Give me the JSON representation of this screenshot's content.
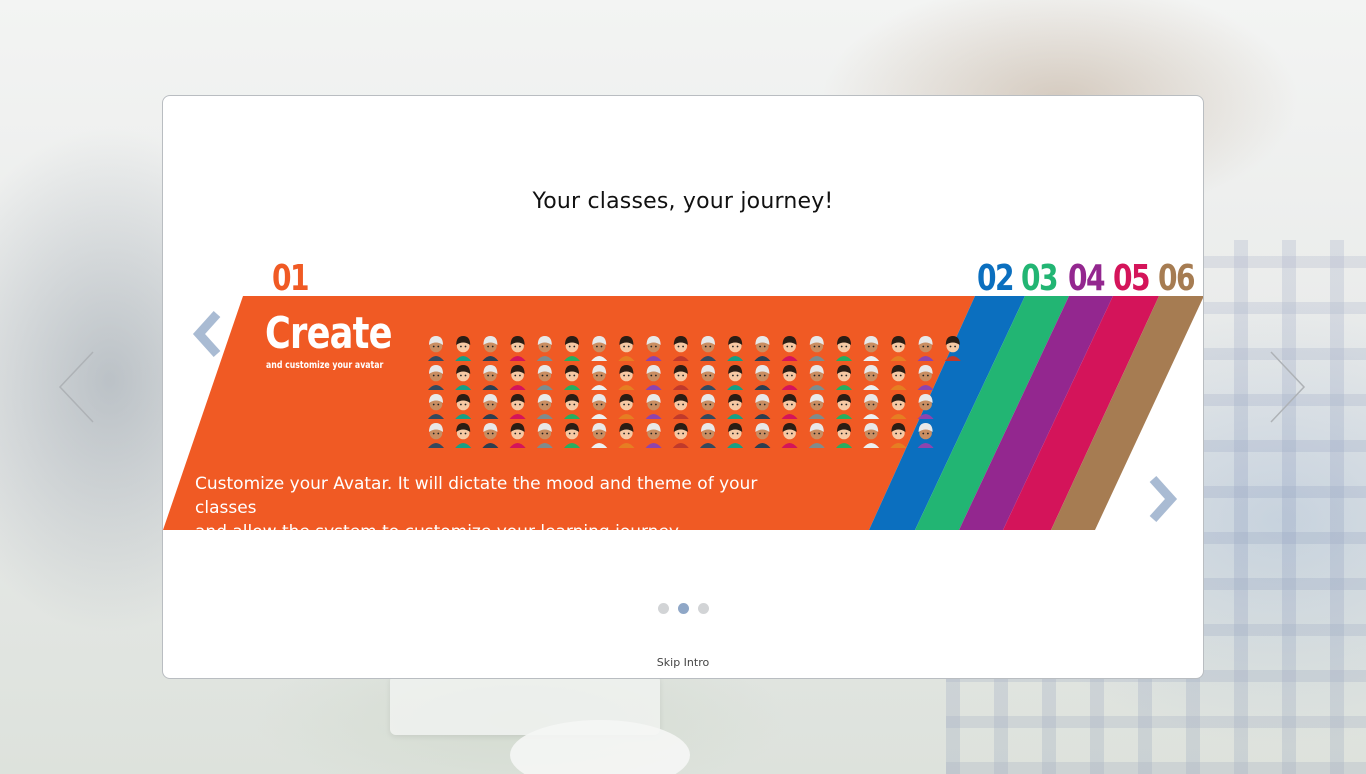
{
  "intro": {
    "headline": "Your classes, your journey!",
    "skip_label": "Skip Intro"
  },
  "slide": {
    "active_step": "01",
    "title": "Create",
    "subtitle": "and customize your avatar",
    "description_line1": "Customize your Avatar. It will dictate the mood and theme of your classes",
    "description_line2": "and allow the system to customize your learning journey."
  },
  "steps": [
    {
      "number": "01",
      "color": "#f05a24"
    },
    {
      "number": "02",
      "color": "#0b6fbf"
    },
    {
      "number": "03",
      "color": "#22b573"
    },
    {
      "number": "04",
      "color": "#93278f"
    },
    {
      "number": "05",
      "color": "#d4145a"
    },
    {
      "number": "06",
      "color": "#a67c52"
    }
  ],
  "carousel": {
    "dot_count": 3,
    "active_dot": 2,
    "dot_color": "#d2d4d6",
    "active_dot_color": "#8fa7c7"
  },
  "icons": {
    "banner_prev": "chevron-left-icon",
    "banner_next": "chevron-right-icon",
    "page_prev": "thin-chevron-left-icon",
    "page_next": "thin-chevron-right-icon",
    "arrow_color": "#a9bbd3"
  },
  "avatar_grid": {
    "rows": 4,
    "columns": 20
  }
}
